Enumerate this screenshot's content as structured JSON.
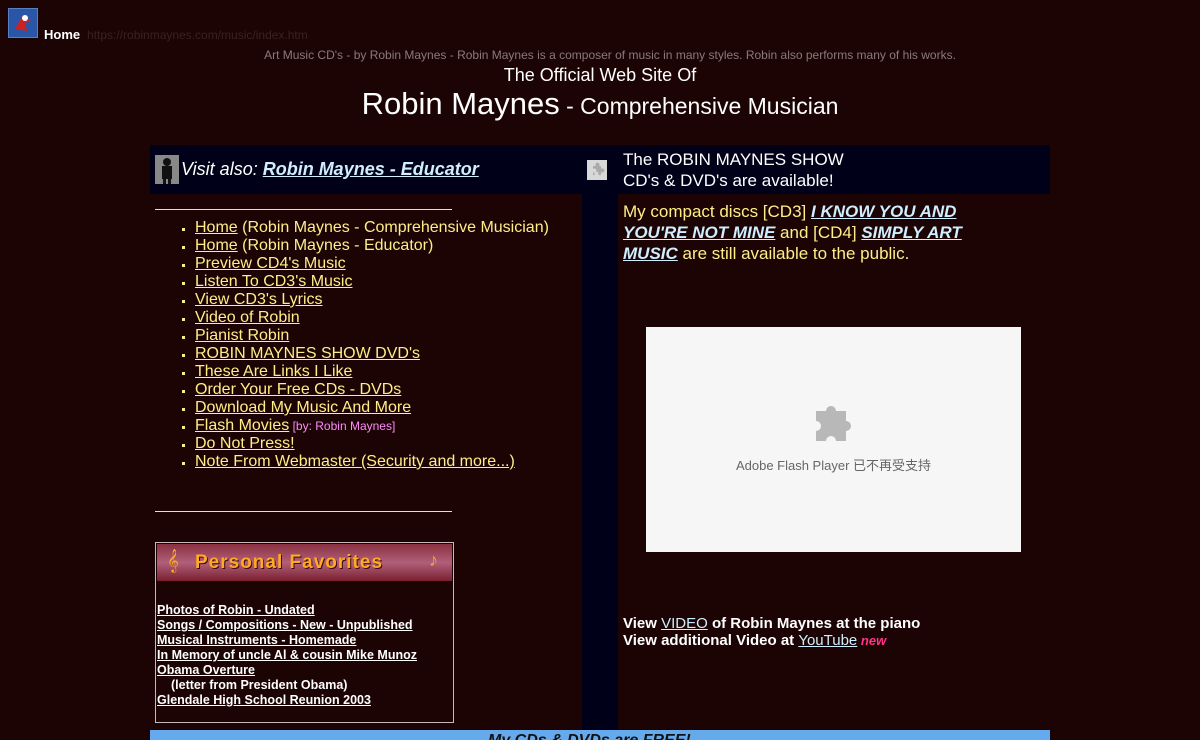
{
  "topbar": {
    "home_label": "Home",
    "home_url": "https://robinmaynes.com/music/index.htm"
  },
  "header": {
    "tagline": "Art Music CD's - by Robin Maynes - Robin Maynes is a composer of music in many styles. Robin also performs many of his works.",
    "official": "The Official Web Site Of",
    "name": "Robin Maynes",
    "subtitle": " - Comprehensive Musician"
  },
  "visit": {
    "prefix": "Visit also: ",
    "link": "Robin Maynes - Educator"
  },
  "show": {
    "line1": "The ROBIN MAYNES SHOW",
    "line2": "CD's & DVD's are available!"
  },
  "nav": [
    {
      "label": "Home",
      "note": " (Robin Maynes - Comprehensive Musician)"
    },
    {
      "label": "Home",
      "note": " (Robin Maynes - Educator)"
    },
    {
      "label": "Preview CD4's Music"
    },
    {
      "label": "Listen To CD3's Music"
    },
    {
      "label": "View CD3's Lyrics"
    },
    {
      "label": "Video of Robin"
    },
    {
      "label": "Pianist Robin"
    },
    {
      "label": "ROBIN MAYNES SHOW DVD's "
    },
    {
      "label": "These Are Links I Like"
    },
    {
      "label": "Order Your Free CDs - DVDs"
    },
    {
      "label": "Download My Music And More"
    },
    {
      "label": "Flash Movies",
      "by": " [by: Robin Maynes]"
    },
    {
      "label": "Do Not Press!"
    },
    {
      "label": "Note From Webmaster (Security and more...)"
    }
  ],
  "favorites": {
    "title": "Personal Favorites",
    "links": [
      "Photos of Robin - Undated",
      "Songs / Compositions - New - Unpublished",
      "Musical Instruments - Homemade",
      "In Memory of uncle Al & cousin Mike Munoz",
      "Obama Overture "
    ],
    "letter_note": "(letter from President Obama)",
    "reunion": "Glendale High School Reunion 2003"
  },
  "cds": {
    "t1": "My compact discs [CD3] ",
    "cd3_title": "I KNOW YOU AND YOU'RE NOT MINE",
    "t2": "  and [CD4] ",
    "cd4_title": "SIMPLY ART MUSIC",
    "t3": " are still available to the public."
  },
  "flash": {
    "message": "Adobe Flash Player 已不再受支持"
  },
  "video": {
    "l1a": "View ",
    "l1link": "VIDEO",
    "l1b": " of Robin Maynes at the piano",
    "l2a": "View additional Video at ",
    "l2link": "YouTube",
    "new": " new"
  },
  "bottom": {
    "banner": "My CDs & DVDs are FREE!"
  },
  "colors": {
    "background": "#1c0404",
    "panel": "#000018",
    "nav_text": "#ffee88",
    "link_blue": "#cfeeff",
    "new_pink": "#ff3388"
  }
}
